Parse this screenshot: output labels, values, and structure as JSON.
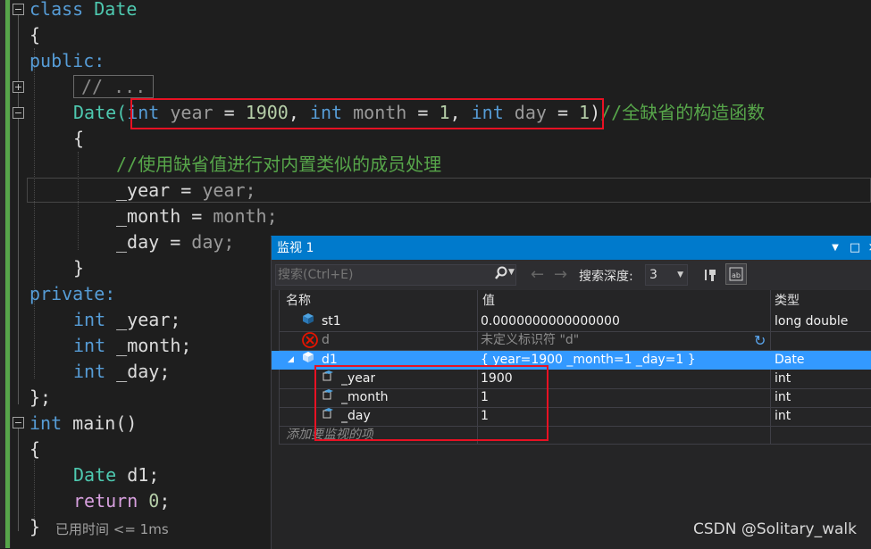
{
  "code": {
    "l1": {
      "kw": "class",
      "name": "Date"
    },
    "l2": {
      "brace": "{"
    },
    "l3": {
      "access": "public:"
    },
    "l4": {
      "collapsed": "// ..."
    },
    "l5": {
      "ctor": "Date(",
      "t1": "int",
      "p1": "year",
      "eq1": " = ",
      "v1": "1900",
      "c1": ", ",
      "t2": "int",
      "p2": "month",
      "eq2": " = ",
      "v2": "1",
      "c2": ", ",
      "t3": "int",
      "p3": "day",
      "eq3": " = ",
      "v3": "1",
      "close": ")",
      "comment": "//全缺省的构造函数"
    },
    "l6": {
      "brace": "{"
    },
    "l7": {
      "comment": "//使用缺省值进行对内置类似的成员处理"
    },
    "l8": {
      "lhs": "_year",
      "op": " = ",
      "rhs": "year;"
    },
    "l9": {
      "lhs": "_month",
      "op": " = ",
      "rhs": "month;"
    },
    "l10": {
      "lhs": "_day",
      "op": " = ",
      "rhs": "day;"
    },
    "l11": {
      "brace": "}"
    },
    "l12": {
      "access": "private:"
    },
    "l13": {
      "type": "int",
      "name": " _year;"
    },
    "l14": {
      "type": "int",
      "name": " _month;"
    },
    "l15": {
      "type": "int",
      "name": " _day;"
    },
    "l16": {
      "brace": "};"
    },
    "l17": {
      "type": "int",
      "name": " main()"
    },
    "l18": {
      "brace": "{"
    },
    "l19": {
      "type": "Date",
      "name": " d1;"
    },
    "l20": {
      "kw": "return",
      "num": " 0",
      "semi": ";"
    },
    "l21": {
      "brace": "}"
    }
  },
  "status": {
    "elapsed": "已用时间 <= 1ms"
  },
  "watch": {
    "title": "监视 1",
    "search_placeholder": "搜索(Ctrl+E)",
    "depth_label": "搜索深度:",
    "depth_value": "3",
    "columns": {
      "name": "名称",
      "value": "值",
      "type": "类型"
    },
    "rows": [
      {
        "name": "st1",
        "value": "0.0000000000000000",
        "type": "long double"
      },
      {
        "name": "d",
        "value": "未定义标识符 \"d\"",
        "type": ""
      },
      {
        "name": "d1",
        "value": "{ year=1900 _month=1 _day=1 }",
        "type": "Date"
      },
      {
        "name": "_year",
        "value": "1900",
        "type": "int"
      },
      {
        "name": "_month",
        "value": "1",
        "type": "int"
      },
      {
        "name": "_day",
        "value": "1",
        "type": "int"
      }
    ],
    "add_item": "添加要监视的项"
  },
  "watermark": "CSDN @Solitary_walk",
  "colors": {
    "accent": "#007acc",
    "selection": "#3399ff",
    "highlight_box": "#e81123",
    "keyword": "#569cd6",
    "comment": "#57a64a",
    "number": "#b5cea8"
  }
}
